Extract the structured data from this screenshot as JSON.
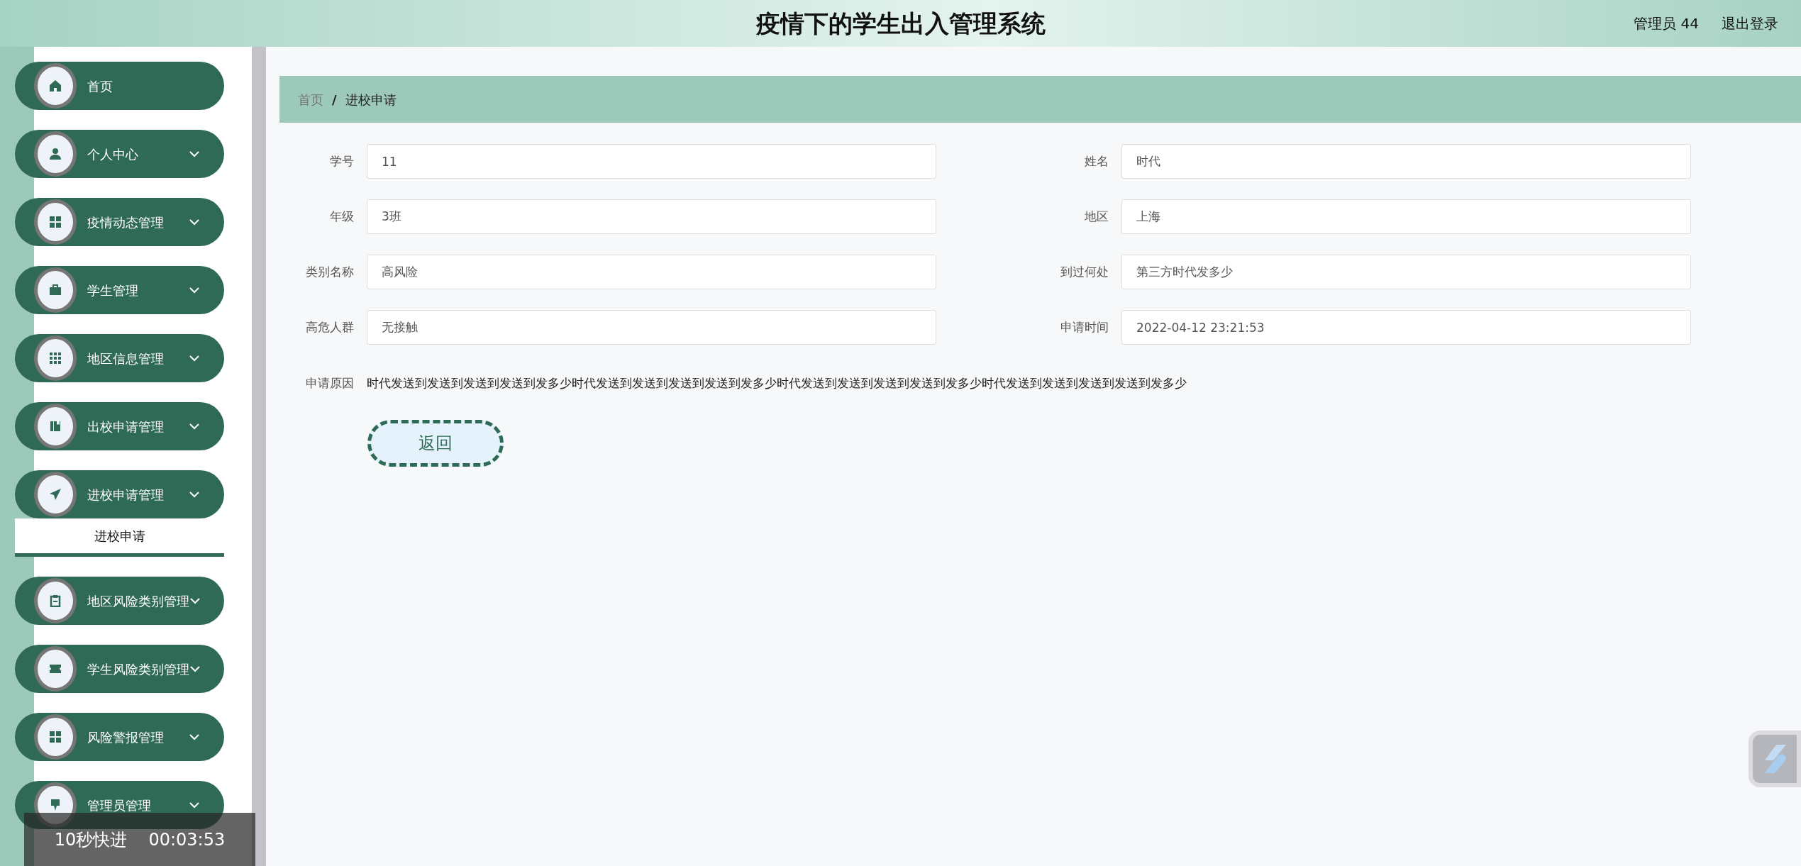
{
  "header": {
    "title": "疫情下的学生出入管理系统",
    "user": "管理员 44",
    "logout": "退出登录"
  },
  "sidebar": {
    "items": [
      {
        "label": "首页",
        "kind": "link"
      },
      {
        "label": "个人中心",
        "kind": "submenu"
      },
      {
        "label": "疫情动态管理",
        "kind": "submenu"
      },
      {
        "label": "学生管理",
        "kind": "submenu"
      },
      {
        "label": "地区信息管理",
        "kind": "submenu"
      },
      {
        "label": "出校申请管理",
        "kind": "submenu"
      },
      {
        "label": "进校申请管理",
        "kind": "submenu",
        "children": [
          {
            "label": "进校申请",
            "selected": true
          }
        ]
      },
      {
        "label": "地区风险类别管理",
        "kind": "submenu"
      },
      {
        "label": "学生风险类别管理",
        "kind": "submenu"
      },
      {
        "label": "风险警报管理",
        "kind": "submenu"
      },
      {
        "label": "管理员管理",
        "kind": "submenu"
      }
    ]
  },
  "breadcrumb": {
    "separator": "/",
    "items": [
      {
        "label": "首页",
        "kind": "link"
      },
      {
        "label": "进校申请",
        "kind": "current"
      }
    ]
  },
  "form": {
    "fields": [
      {
        "label": "学号",
        "value": "11"
      },
      {
        "label": "姓名",
        "value": "时代"
      },
      {
        "label": "年级",
        "value": "3班"
      },
      {
        "label": "地区",
        "value": "上海"
      },
      {
        "label": "类别名称",
        "value": "高风险"
      },
      {
        "label": "到过何处",
        "value": "第三方时代发多少"
      },
      {
        "label": "高危人群",
        "value": "无接触"
      },
      {
        "label": "申请时间",
        "value": "2022-04-12 23:21:53"
      }
    ],
    "reason": {
      "label": "申请原因",
      "text": "时代发送到发送到发送到发送到发多少时代发送到发送到发送到发送到发多少时代发送到发送到发送到发送到发多少时代发送到发送到发送到发送到发多少"
    },
    "back_button": "返回"
  },
  "video_overlay": {
    "label": "10秒快进",
    "time": "00:03:53"
  }
}
